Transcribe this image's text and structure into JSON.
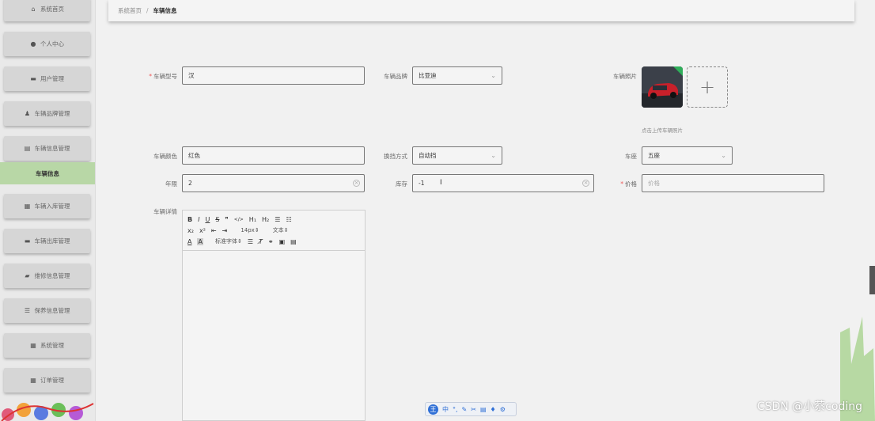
{
  "sidebar": {
    "items": [
      {
        "label": "系统首页",
        "icon": "home-icon"
      },
      {
        "label": "个人中心",
        "icon": "user-icon"
      },
      {
        "label": "用户管理",
        "icon": "monitor-icon"
      },
      {
        "label": "车辆品牌管理",
        "icon": "person-icon"
      },
      {
        "label": "车辆信息管理",
        "icon": "document-icon"
      },
      {
        "label": "车辆入库管理",
        "icon": "grid-icon"
      },
      {
        "label": "车辆出库管理",
        "icon": "chat-icon"
      },
      {
        "label": "维修信息管理",
        "icon": "ticket-icon"
      },
      {
        "label": "保养信息管理",
        "icon": "sliders-icon"
      },
      {
        "label": "系统管理",
        "icon": "grid-icon"
      },
      {
        "label": "订单管理",
        "icon": "grid-icon"
      }
    ],
    "active_sub": "车辆信息"
  },
  "breadcrumb": {
    "home": "系统首页",
    "separator": "/",
    "current": "车辆信息"
  },
  "form": {
    "model": {
      "label": "车辆型号",
      "required": "*",
      "value": "汉"
    },
    "brand": {
      "label": "车辆品牌",
      "value": "比亚迪"
    },
    "photo": {
      "label": "车辆照片",
      "hint": "点击上传车辆照片",
      "plus": "+"
    },
    "color": {
      "label": "车辆颜色",
      "value": "红色"
    },
    "gearbox": {
      "label": "换挡方式",
      "value": "自动挡"
    },
    "seats": {
      "label": "车座",
      "value": "五座"
    },
    "years": {
      "label": "年限",
      "value": "2"
    },
    "stock": {
      "label": "库存",
      "value": "-1"
    },
    "price": {
      "label": "价格",
      "required": "*",
      "placeholder": "价格"
    },
    "details": {
      "label": "车辆详情"
    }
  },
  "editor": {
    "row1": [
      "B",
      "I",
      "U",
      "S",
      "❞",
      "</>",
      "H₁",
      "H₂",
      "☰",
      "☷"
    ],
    "row2": [
      "x₂",
      "x²",
      "⇤",
      "⇥"
    ],
    "font_size": "14px",
    "text_style": "文本",
    "font_family": "标准字体"
  },
  "ime": {
    "badge": "王",
    "lang": "中"
  },
  "watermark": "CSDN @小蔡coding",
  "colors": {
    "active_menu": "#b8d7a6",
    "accent": "#2f6fd6"
  }
}
